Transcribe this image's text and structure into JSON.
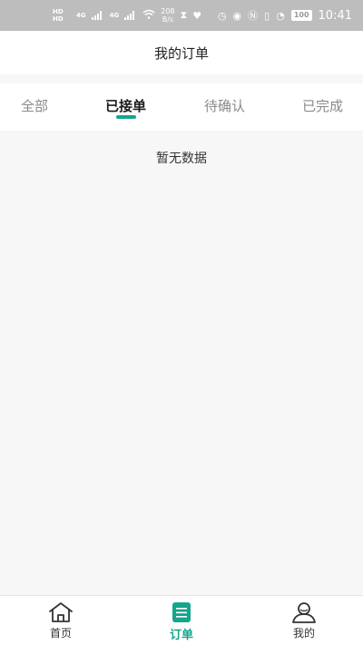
{
  "status_bar": {
    "hd1": "HD",
    "hd2": "HD",
    "net1": "4G",
    "net2": "4G",
    "speed_value": "208",
    "speed_unit": "B/s",
    "battery": "100",
    "time": "10:41"
  },
  "header": {
    "title": "我的订单"
  },
  "tabs": [
    {
      "label": "全部",
      "active": false
    },
    {
      "label": "已接单",
      "active": true
    },
    {
      "label": "待确认",
      "active": false
    },
    {
      "label": "已完成",
      "active": false
    }
  ],
  "content": {
    "empty_text": "暂无数据"
  },
  "bottom_nav": [
    {
      "label": "首页",
      "icon": "home-icon",
      "active": false
    },
    {
      "label": "订单",
      "icon": "order-list-icon",
      "active": true
    },
    {
      "label": "我的",
      "icon": "user-icon",
      "active": false
    }
  ],
  "colors": {
    "accent": "#14a58e",
    "status_bar": "#bdbdbd"
  }
}
